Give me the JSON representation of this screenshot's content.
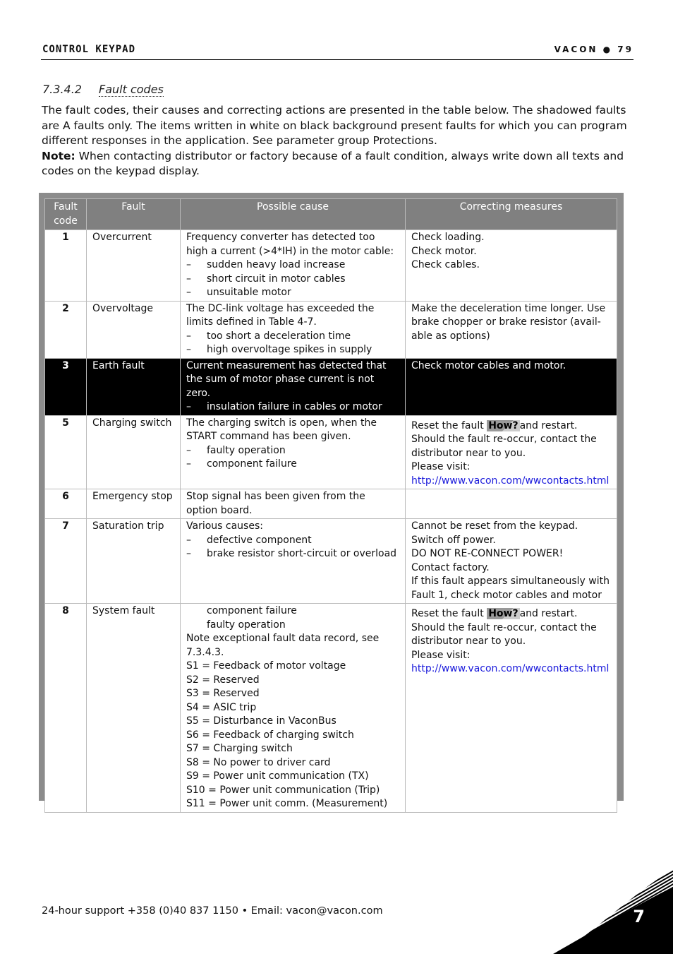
{
  "header": {
    "left": "CONTROL KEYPAD",
    "right": "VACON ● 79"
  },
  "section": {
    "number": "7.3.4.2",
    "title": "Fault codes"
  },
  "intro": {
    "paragraph": "The fault codes, their causes and correcting actions are presented in the table below. The shadowed faults are A faults only. The items written in white on black background present faults for which you can program different responses in the application. See parameter group Protections.",
    "note_label": "Note:",
    "note_text": " When contacting distributor or factory because of a fault condition, always write down all texts and codes on the keypad display."
  },
  "table": {
    "headers": [
      "Fault code",
      "Fault",
      "Possible cause",
      "Correcting measures"
    ],
    "rows": [
      {
        "code": "1",
        "fault": "Overcurrent",
        "cause_lines": [
          "Frequency converter has detected too",
          "high a current (>4*IH) in the motor cable:"
        ],
        "cause_bullets": [
          "sudden heavy load increase",
          "short circuit in motor cables",
          "unsuitable motor"
        ],
        "measures": [
          "Check loading.",
          "Check motor.",
          "Check cables."
        ]
      },
      {
        "code": "2",
        "fault": "Overvoltage",
        "cause_lines": [
          "The DC-link voltage has exceeded the limits defined in Table 4-7."
        ],
        "cause_bullets": [
          "too short a deceleration time",
          "high overvoltage spikes in supply"
        ],
        "measures": [
          "Make the deceleration time longer. Use brake chopper or brake resistor (avail-able as options)"
        ]
      },
      {
        "code": "3",
        "fault": "Earth fault",
        "dark": true,
        "cause_lines": [
          "Current measurement has detected that the sum of motor phase current is not zero."
        ],
        "cause_bullets": [
          "insulation failure in cables or motor"
        ],
        "measures": [
          "Check motor cables and motor."
        ]
      },
      {
        "code": "5",
        "fault": "Charging switch",
        "cause_lines": [
          "The charging switch is open, when the START command has been given."
        ],
        "cause_bullets": [
          "faulty operation",
          "component failure"
        ],
        "measures_reset": {
          "pre": "Reset the fault ",
          "how": "How?",
          "post": "and restart."
        },
        "measures": [
          "Should the fault re-occur, contact the distributor near to you.",
          "Please visit:"
        ],
        "link": "http://www.vacon.com/wwcontacts.html"
      },
      {
        "code": "6",
        "fault": "Emergency stop",
        "cause_lines": [
          "Stop signal has been given from the option board."
        ],
        "cause_bullets": [],
        "measures": []
      },
      {
        "code": "7",
        "fault": "Saturation trip",
        "cause_lines": [
          "Various causes:"
        ],
        "cause_bullets": [
          "defective component",
          "brake resistor short-circuit or overload"
        ],
        "measures": [
          "Cannot be reset from the keypad.",
          "Switch off power.",
          "DO NOT RE-CONNECT POWER!",
          "Contact factory.",
          "If this fault appears simultaneously with Fault 1, check motor cables and motor"
        ]
      },
      {
        "code": "8",
        "fault": "System fault",
        "cause_indented": [
          "component failure",
          "faulty operation"
        ],
        "cause_lines": [
          "Note exceptional fault data record, see 7.3.4.3.",
          "S1 = Feedback of motor voltage",
          "S2 = Reserved",
          "S3 = Reserved",
          "S4 = ASIC trip",
          "S5 = Disturbance in VaconBus",
          "S6 = Feedback of charging switch",
          "S7 = Charging switch",
          "S8 = No power to driver card",
          "S9 = Power unit communication (TX)",
          "S10 = Power unit communication (Trip)",
          "S11 = Power unit comm. (Measurement)"
        ],
        "cause_bullets": [],
        "measures_reset": {
          "pre": "Reset the fault ",
          "how": "How?",
          "post": "and restart."
        },
        "measures": [
          "Should the fault re-occur, contact the distributor near to you.",
          "Please visit:"
        ],
        "link": "http://www.vacon.com/wwcontacts.html"
      }
    ]
  },
  "footer": {
    "support": "24-hour support +358 (0)40 837 1150 • Email: vacon@vacon.com",
    "chapter": "7"
  }
}
